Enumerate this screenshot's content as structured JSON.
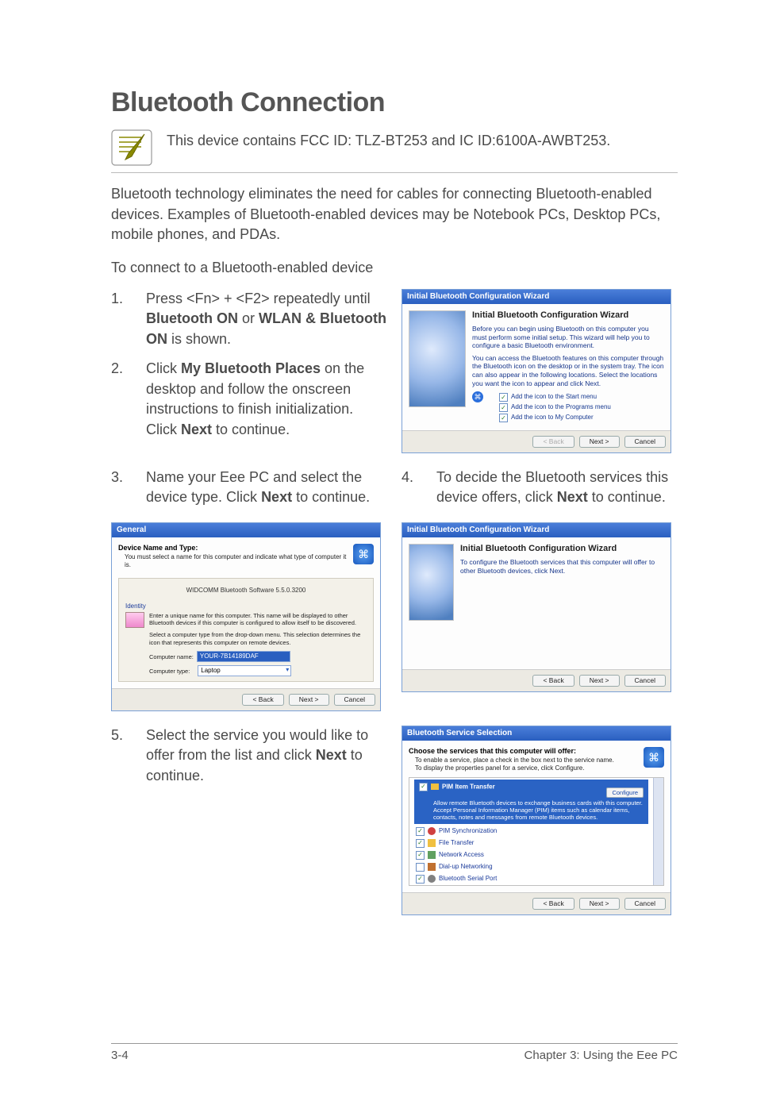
{
  "title": "Bluetooth Connection",
  "note": "This device contains FCC ID: TLZ-BT253 and IC ID:6100A-AWBT253.",
  "intro": "Bluetooth technology eliminates the need for cables for connecting Bluetooth-enabled devices. Examples of Bluetooth-enabled devices may be Notebook PCs, Desktop PCs, mobile phones, and PDAs.",
  "lead": "To connect to a Bluetooth-enabled device",
  "steps": {
    "s1": {
      "num": "1.",
      "a": "Press <Fn> + <F2> repeatedly until ",
      "b": "Bluetooth ON",
      "c": " or ",
      "d": "WLAN & Bluetooth ON",
      "e": " is shown."
    },
    "s2": {
      "num": "2.",
      "a": "Click ",
      "b": "My Bluetooth Places",
      "c": " on the desktop and follow the onscreen instructions to finish initialization. Click ",
      "d": "Next",
      "e": " to continue."
    },
    "s3": {
      "num": "3.",
      "a": "Name your Eee PC and select the device type. Click ",
      "b": "Next",
      "c": " to continue."
    },
    "s4": {
      "num": "4.",
      "a": "To decide the Bluetooth services this device offers, click ",
      "b": "Next",
      "c": " to continue."
    },
    "s5": {
      "num": "5.",
      "a": "Select the service you would like to offer from the list and click ",
      "b": "Next",
      "c": " to continue."
    }
  },
  "wiz1": {
    "title": "Initial Bluetooth Configuration Wizard",
    "h": "Initial Bluetooth Configuration Wizard",
    "p1": "Before you can begin using Bluetooth on this computer you must perform some initial setup. This wizard will help you to configure a basic Bluetooth environment.",
    "p2": "You can access the Bluetooth features on this computer through the Bluetooth icon on the desktop or in the system tray. The icon can also appear in the following locations. Select the locations you want the icon to appear and click Next.",
    "chk1": "Add the icon to the Start menu",
    "chk2": "Add the icon to the Programs menu",
    "chk3": "Add the icon to My Computer",
    "back": "< Back",
    "next": "Next >",
    "cancel": "Cancel"
  },
  "wiz3": {
    "title": "General",
    "head": "Device Name and Type:",
    "sub": "You must select a name for this computer and indicate what type of computer it is.",
    "sw": "WIDCOMM Bluetooth Software 5.5.0.3200",
    "identity": "Identity",
    "id1": "Enter a unique name for this computer. This name will be displayed to other Bluetooth devices if this computer is configured to allow itself to be discovered.",
    "id2": "Select a computer type from the drop-down menu. This selection determines the icon that represents this computer on remote devices.",
    "name_label": "Computer name:",
    "name_value": "YOUR-7B14189DAF",
    "type_label": "Computer type:",
    "type_value": "Laptop",
    "back": "< Back",
    "next": "Next >",
    "cancel": "Cancel"
  },
  "wiz4": {
    "title": "Initial Bluetooth Configuration Wizard",
    "h": "Initial Bluetooth Configuration Wizard",
    "p": "To configure the Bluetooth services that this computer will offer to other Bluetooth devices, click Next.",
    "back": "< Back",
    "next": "Next >",
    "cancel": "Cancel"
  },
  "wiz5": {
    "title": "Bluetooth Service Selection",
    "head": "Choose the services that this computer will offer:",
    "sub1": "To enable a service, place a check in the box next to the service name.",
    "sub2": "To display the properties panel for a service, click Configure.",
    "svc_head": "PIM Item Transfer",
    "svc_desc": "Allow remote Bluetooth devices to exchange business cards with this computer. Accept Personal Information Manager (PIM) items such as calendar items, contacts, notes and messages from remote Bluetooth devices.",
    "cfg": "Configure",
    "items": {
      "i1": "PIM Synchronization",
      "i2": "File Transfer",
      "i3": "Network Access",
      "i4": "Dial-up Networking",
      "i5": "Bluetooth Serial Port"
    },
    "back": "< Back",
    "next": "Next >",
    "cancel": "Cancel"
  },
  "footer": {
    "left": "3-4",
    "right": "Chapter 3: Using the Eee PC"
  }
}
